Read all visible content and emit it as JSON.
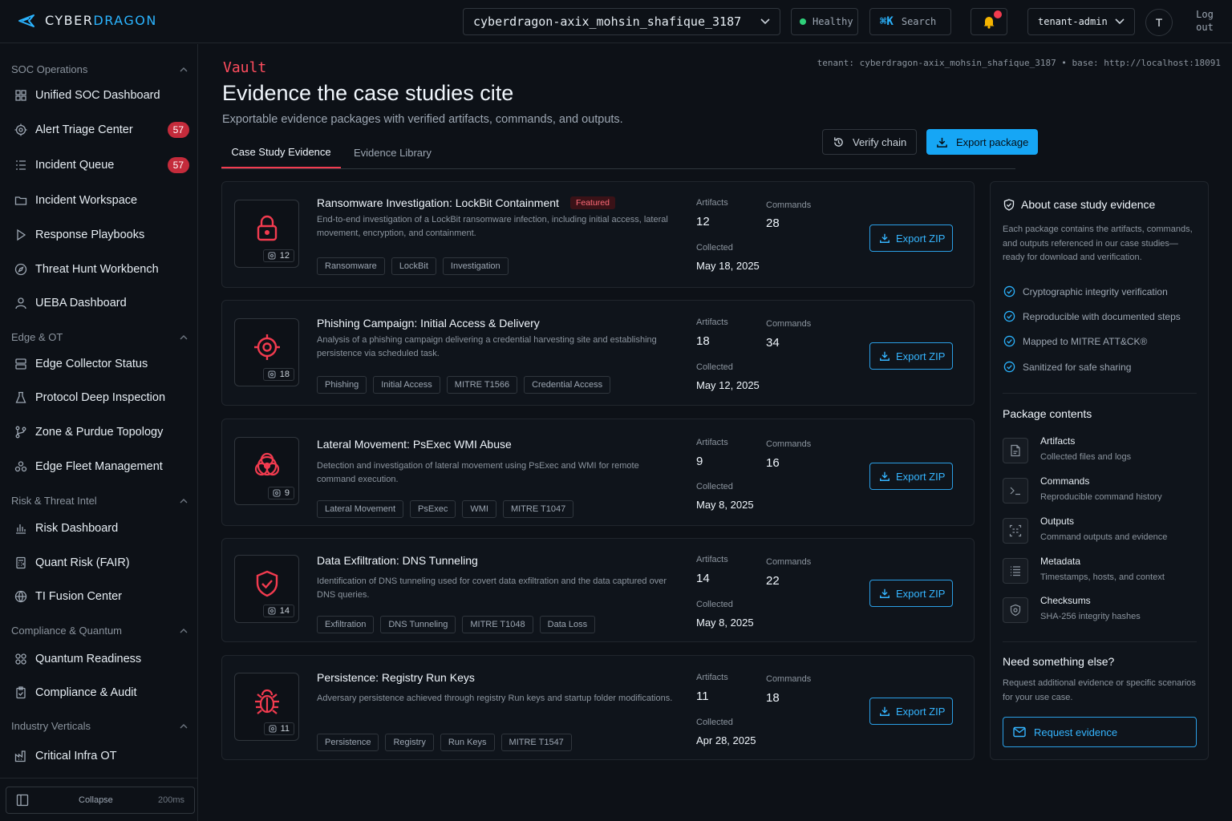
{
  "brand": {
    "word1": "CYBER",
    "word2": "DRAGON"
  },
  "topbar": {
    "tenant": "cyberdragon-axix_mohsin_shafique_3187",
    "health": "Healthy",
    "search_key": "⌘K",
    "search_label": "Search",
    "role": "tenant-admin",
    "avatar": "T",
    "logout_line1": "Log",
    "logout_line2": "out"
  },
  "sidebar": {
    "sections": [
      {
        "label": "SOC Operations",
        "items": [
          {
            "label": "Unified SOC Dashboard",
            "icon": "grid-icon"
          },
          {
            "label": "Alert Triage Center",
            "icon": "target-icon",
            "count": "57"
          },
          {
            "label": "Incident Queue",
            "icon": "list-icon",
            "count": "57"
          },
          {
            "label": "Incident Workspace",
            "icon": "folder-icon"
          },
          {
            "label": "Response Playbooks",
            "icon": "play-icon"
          },
          {
            "label": "Threat Hunt Workbench",
            "icon": "compass-icon"
          },
          {
            "label": "UEBA Dashboard",
            "icon": "user-icon"
          }
        ]
      },
      {
        "label": "Edge & OT",
        "items": [
          {
            "label": "Edge Collector Status",
            "icon": "server-icon"
          },
          {
            "label": "Protocol Deep Inspection",
            "icon": "flask-icon"
          },
          {
            "label": "Zone & Purdue Topology",
            "icon": "branch-icon"
          },
          {
            "label": "Edge Fleet Management",
            "icon": "boxes-icon"
          }
        ]
      },
      {
        "label": "Risk & Threat Intel",
        "items": [
          {
            "label": "Risk Dashboard",
            "icon": "bar-chart-icon"
          },
          {
            "label": "Quant Risk (FAIR)",
            "icon": "calculator-icon"
          },
          {
            "label": "TI Fusion Center",
            "icon": "globe-icon"
          }
        ]
      },
      {
        "label": "Compliance & Quantum",
        "items": [
          {
            "label": "Quantum Readiness",
            "icon": "atom-icon"
          },
          {
            "label": "Compliance & Audit",
            "icon": "clipboard-icon"
          }
        ]
      },
      {
        "label": "Industry Verticals",
        "items": [
          {
            "label": "Critical Infra OT",
            "icon": "factory-icon"
          }
        ]
      }
    ],
    "collapse_label": "Collapse",
    "collapse_ms": "200ms"
  },
  "header": {
    "meta": "tenant: cyberdragon-axix_mohsin_shafique_3187 • base: http://localhost:18091",
    "kicker": "Vault",
    "title": "Evidence the case studies cite",
    "subtitle": "Exportable evidence packages with verified artifacts, commands, and outputs.",
    "tabs": [
      "Case Study Evidence",
      "Evidence Library"
    ],
    "verify_label": "Verify chain",
    "export_label": "Export package"
  },
  "labels": {
    "artifacts": "Artifacts",
    "commands": "Commands",
    "collected": "Collected",
    "export_zip": "Export ZIP",
    "featured": "Featured"
  },
  "cases": [
    {
      "title": "Ransomware Investigation: LockBit Containment",
      "featured": true,
      "desc": "End-to-end investigation of a LockBit ransomware infection, including initial access, lateral movement, encryption, and containment.",
      "tags": [
        "Ransomware",
        "LockBit",
        "Investigation"
      ],
      "artifacts": "12",
      "commands": "28",
      "collected": "May 18, 2025",
      "icon": "lock-icon"
    },
    {
      "title": "Phishing Campaign: Initial Access & Delivery",
      "featured": false,
      "desc": "Analysis of a phishing campaign delivering a credential harvesting site and establishing persistence via scheduled task.",
      "tags": [
        "Phishing",
        "Initial Access",
        "MITRE T1566",
        "Credential Access"
      ],
      "artifacts": "18",
      "commands": "34",
      "collected": "May 12, 2025",
      "icon": "crosshair-icon"
    },
    {
      "title": "Lateral Movement: PsExec WMI Abuse",
      "featured": false,
      "desc": "Detection and investigation of lateral movement using PsExec and WMI for remote command execution.",
      "tags": [
        "Lateral Movement",
        "PsExec",
        "WMI",
        "MITRE T1047"
      ],
      "artifacts": "9",
      "commands": "16",
      "collected": "May 8, 2025",
      "icon": "biohazard-icon"
    },
    {
      "title": "Data Exfiltration: DNS Tunneling",
      "featured": false,
      "desc": "Identification of DNS tunneling used for covert data exfiltration and the data captured over DNS queries.",
      "tags": [
        "Exfiltration",
        "DNS Tunneling",
        "MITRE T1048",
        "Data Loss"
      ],
      "artifacts": "14",
      "commands": "22",
      "collected": "May 8, 2025",
      "icon": "shield-check-icon"
    },
    {
      "title": "Persistence: Registry Run Keys",
      "featured": false,
      "desc": "Adversary persistence achieved through registry Run keys and startup folder modifications.",
      "tags": [
        "Persistence",
        "Registry",
        "Run Keys",
        "MITRE T1547"
      ],
      "artifacts": "11",
      "commands": "18",
      "collected": "Apr 28, 2025",
      "icon": "bug-icon"
    }
  ],
  "panel": {
    "title": "About case study evidence",
    "intro": "Each package contains the artifacts, commands, and outputs referenced in our case studies—ready for download and verification.",
    "checks": [
      "Cryptographic integrity verification",
      "Reproducible with documented steps",
      "Mapped to MITRE ATT&CK®",
      "Sanitized for safe sharing"
    ],
    "contents_title": "Package contents",
    "contents": [
      {
        "name": "Artifacts",
        "desc": "Collected files and logs",
        "icon": "file-icon"
      },
      {
        "name": "Commands",
        "desc": "Reproducible command history",
        "icon": "terminal-icon"
      },
      {
        "name": "Outputs",
        "desc": "Command outputs and evidence",
        "icon": "output-icon"
      },
      {
        "name": "Metadata",
        "desc": "Timestamps, hosts, and context",
        "icon": "list-icon"
      },
      {
        "name": "Checksums",
        "desc": "SHA-256 integrity hashes",
        "icon": "shield-hash-icon"
      }
    ],
    "else_title": "Need something else?",
    "else_text": "Request additional evidence or specific scenarios for your use case.",
    "request_label": "Request evidence"
  }
}
